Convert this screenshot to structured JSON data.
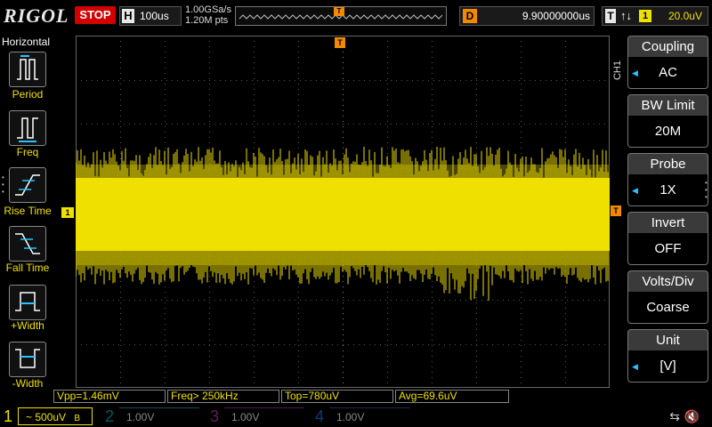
{
  "header": {
    "logo": "RIGOL",
    "run_state": "STOP",
    "horizontal": {
      "key": "H",
      "timebase": "100us"
    },
    "sample_rate": "1.00GSa/s",
    "memory_depth": "1.20M pts",
    "trigger_marker": "T",
    "delay": {
      "key": "D",
      "value": "9.90000000us"
    },
    "trigger": {
      "key": "T",
      "edge_symbol": "↑↓",
      "source": "1",
      "level": "20.0uV"
    }
  },
  "left_panel": {
    "title": "Horizontal",
    "buttons": [
      {
        "label": "Period",
        "icon": "period-icon"
      },
      {
        "label": "Freq",
        "icon": "freq-icon"
      },
      {
        "label": "Rise Time",
        "icon": "rise-time-icon"
      },
      {
        "label": "Fall Time",
        "icon": "fall-time-icon"
      },
      {
        "label": "+Width",
        "icon": "pos-width-icon"
      },
      {
        "label": "-Width",
        "icon": "neg-width-icon"
      }
    ]
  },
  "markers": {
    "channel_marker": "1",
    "trigger_top": "T",
    "trigger_level": "T"
  },
  "right_panel": {
    "channel_tag": "CH1",
    "groups": [
      {
        "title": "Coupling",
        "value": "AC",
        "has_arrow": true
      },
      {
        "title": "BW Limit",
        "value": "20M",
        "has_arrow": false
      },
      {
        "title": "Probe",
        "value": "1X",
        "has_arrow": true
      },
      {
        "title": "Invert",
        "value": "OFF",
        "has_arrow": false
      },
      {
        "title": "Volts/Div",
        "value": "Coarse",
        "has_arrow": false
      },
      {
        "title": "Unit",
        "value": "[V]",
        "has_arrow": true
      }
    ]
  },
  "measurements": {
    "vpp": "Vpp=1.46mV",
    "freq": "Freq> 250kHz",
    "top": "Top=780uV",
    "avg": "Avg=69.6uV"
  },
  "channels": [
    {
      "num": "1",
      "scale": "~ 500uV",
      "suffix": "B",
      "color": "#f0e000",
      "active": true
    },
    {
      "num": "2",
      "scale": "1.00V",
      "color": "#00c8c8",
      "active": false
    },
    {
      "num": "3",
      "scale": "1.00V",
      "color": "#d040d0",
      "active": false
    },
    {
      "num": "4",
      "scale": "1.00V",
      "color": "#2080ff",
      "active": false
    }
  ],
  "status_icons": {
    "usb": "usb-icon",
    "speaker": "speaker-muted-icon"
  },
  "colors": {
    "ch1": "#f0e000",
    "trigger": "#f28a00",
    "stop": "#d20000",
    "arrow": "#29c3ff"
  }
}
